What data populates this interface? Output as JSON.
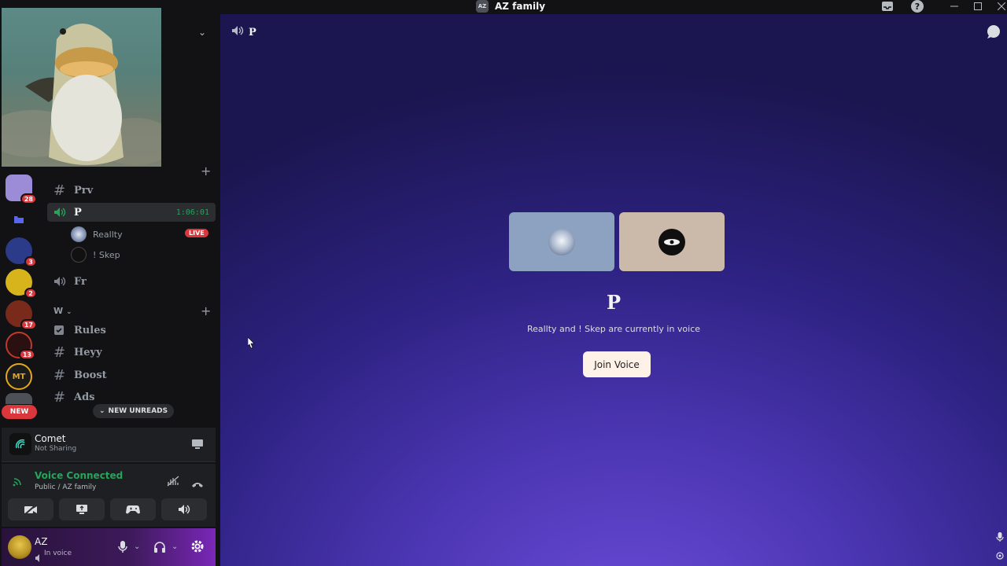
{
  "window": {
    "title": "AZ family",
    "server_icon_text": "AZ"
  },
  "guilds": [
    {
      "badge": "28"
    },
    {
      "badge": ""
    },
    {
      "badge": "3"
    },
    {
      "badge": "2"
    },
    {
      "badge": "17"
    },
    {
      "badge": "13"
    },
    {
      "icon_text": "MT",
      "badge": ""
    }
  ],
  "new_pill": "NEW",
  "channels": {
    "prv": "Prv",
    "p": "P",
    "p_timer": "1:06:01",
    "fr": "Fr",
    "category_w": "W",
    "rules": "Rules",
    "heyy": "Heyy",
    "boost": "Boost",
    "ads": "Ads"
  },
  "voice_users": [
    {
      "name": "Reallty",
      "live": "LIVE"
    },
    {
      "name": "! Skep"
    }
  ],
  "new_unreads": "NEW UNREADS",
  "stream": {
    "name": "Comet",
    "status": "Not Sharing"
  },
  "voice": {
    "title": "Voice Connected",
    "subtitle": "Public / AZ family"
  },
  "user": {
    "name": "AZ",
    "status": "In voice"
  },
  "main": {
    "channel_name": "P",
    "description": "Reallty and ! Skep are currently in voice",
    "join_label": "Join Voice"
  },
  "colors": {
    "accent_green": "#23a55a",
    "badge_red": "#da373c",
    "tile_1": "#8da1c0",
    "tile_2": "#cbb9a9"
  }
}
